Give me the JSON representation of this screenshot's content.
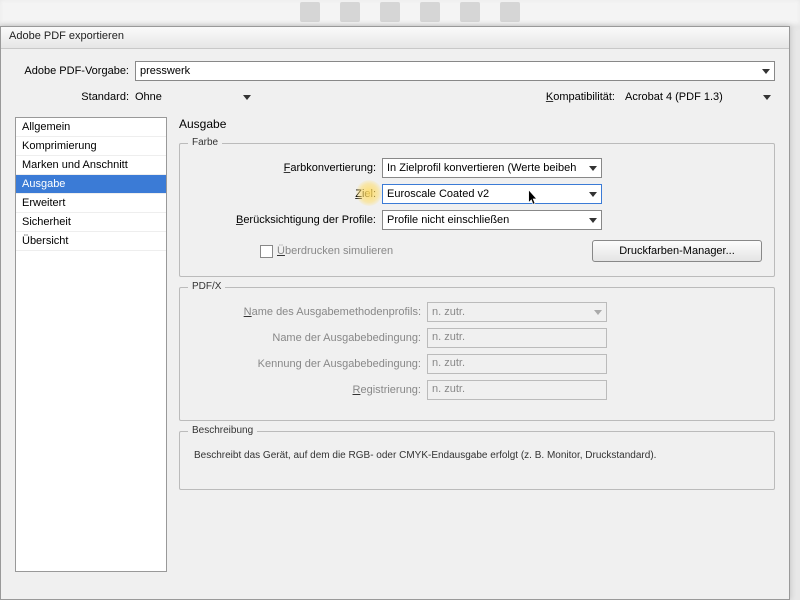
{
  "dialog": {
    "title": "Adobe PDF exportieren"
  },
  "preset": {
    "label": "Adobe PDF-Vorgabe:",
    "value": "presswerk"
  },
  "standard": {
    "label": "Standard:",
    "value": "Ohne"
  },
  "compat": {
    "label": "Kompatibilität:",
    "label_prefix": "K",
    "label_rest": "ompatibilität:",
    "value": "Acrobat 4 (PDF 1.3)"
  },
  "sidebar": {
    "items": [
      {
        "label": "Allgemein"
      },
      {
        "label": "Komprimierung"
      },
      {
        "label": "Marken und Anschnitt"
      },
      {
        "label": "Ausgabe"
      },
      {
        "label": "Erweitert"
      },
      {
        "label": "Sicherheit"
      },
      {
        "label": "Übersicht"
      }
    ],
    "selected_index": 3
  },
  "main": {
    "title": "Ausgabe",
    "farbe": {
      "legend": "Farbe",
      "conversion": {
        "label_prefix": "F",
        "label_rest": "arbkonvertierung:",
        "value": "In Zielprofil konvertieren (Werte beibeh"
      },
      "ziel": {
        "label_prefix": "Z",
        "label_rest": "iel:",
        "value": "Euroscale Coated v2"
      },
      "profiles": {
        "label_prefix": "B",
        "label_rest": "erücksichtigung der Profile:",
        "value": "Profile nicht einschließen"
      },
      "overprint": {
        "label_prefix": "Ü",
        "label_rest": "berdrucken simulieren"
      },
      "ink_manager": {
        "label": "Druckfarben-Manager..."
      }
    },
    "pdfx": {
      "legend": "PDF/X",
      "output_profile": {
        "label_prefix": "N",
        "label_rest": "ame des Ausgabemethodenprofils:",
        "value": "n. zutr."
      },
      "condition_name": {
        "label": "Name der Ausgabebedingung:",
        "value": "n. zutr."
      },
      "condition_id": {
        "label": "Kennung der Ausgabebedingung:",
        "value": "n. zutr."
      },
      "registry": {
        "label_prefix": "R",
        "label_rest": "egistrierung:",
        "value": "n. zutr."
      }
    },
    "description": {
      "legend": "Beschreibung",
      "text": "Beschreibt das Gerät, auf dem die RGB- oder CMYK-Endausgabe erfolgt (z. B. Monitor, Druckstandard)."
    }
  }
}
